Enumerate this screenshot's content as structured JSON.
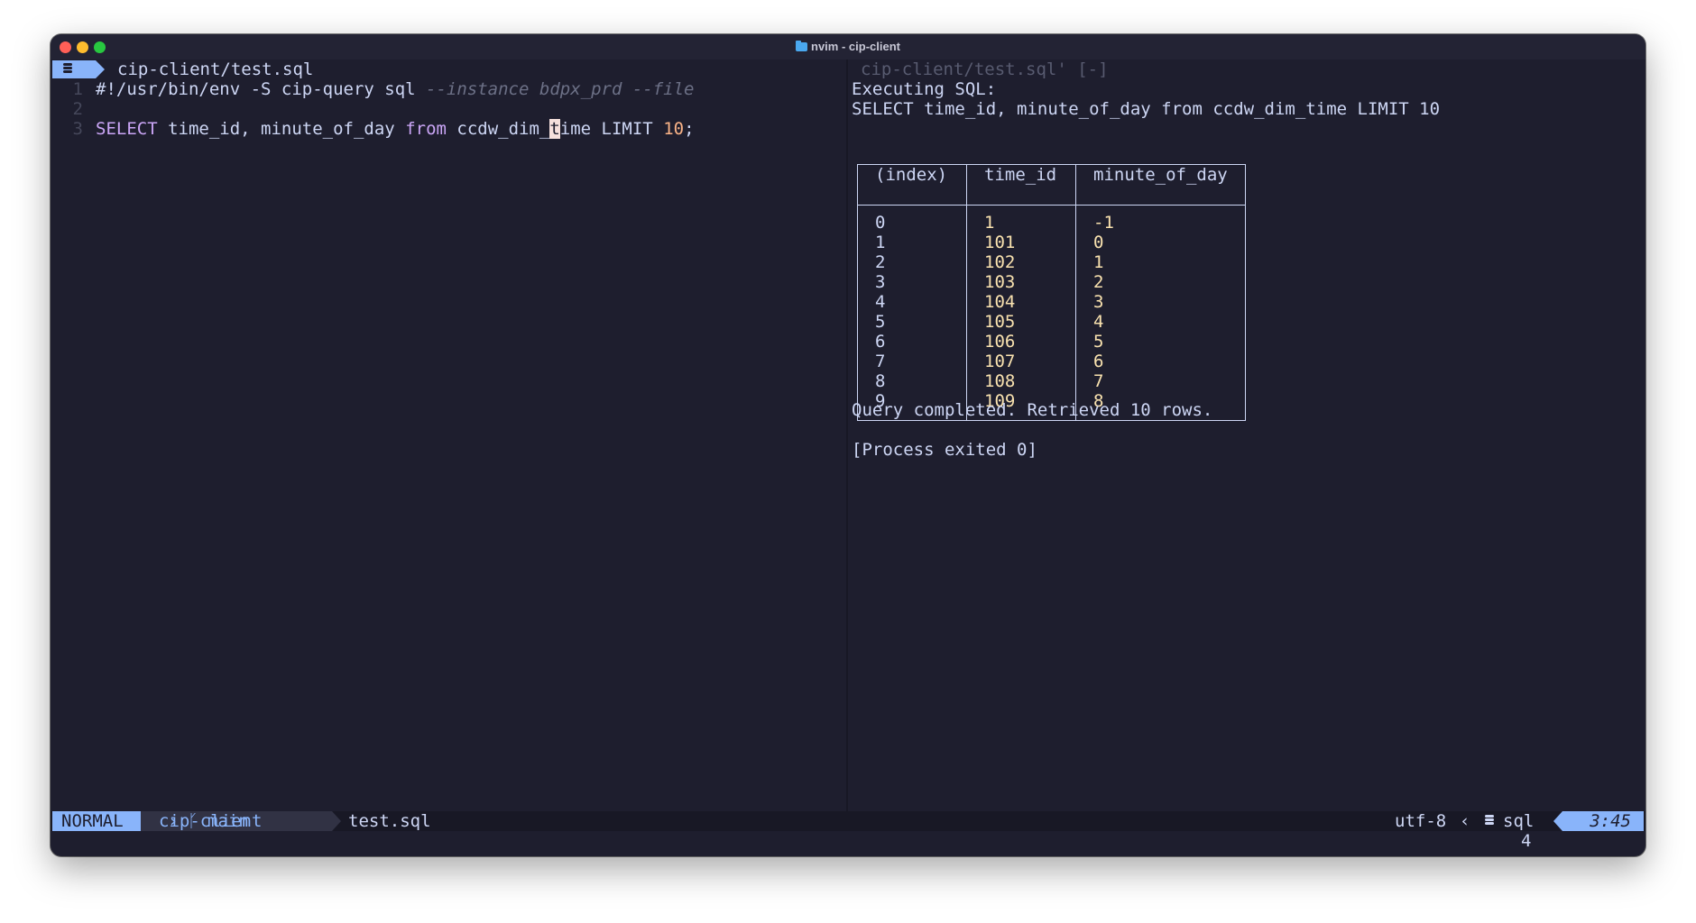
{
  "window": {
    "title": "nvim - cip-client"
  },
  "left_pane": {
    "tab_filename": "cip-client/test.sql",
    "lines": [
      {
        "num": "1",
        "parts": [
          {
            "t": "#!/usr/bin/env -S cip-query sql ",
            "c": "plain"
          },
          {
            "t": "--instance bdpx_prd --file",
            "c": "cm"
          }
        ]
      },
      {
        "num": "2",
        "parts": []
      },
      {
        "num": "3",
        "parts": [
          {
            "t": "SELECT",
            "c": "kw"
          },
          {
            "t": " time_id, minute_of_day ",
            "c": "plain"
          },
          {
            "t": "from",
            "c": "kw"
          },
          {
            "t": " ccdw_dim_",
            "c": "plain"
          },
          {
            "t": "t",
            "c": "cursor"
          },
          {
            "t": "ime LIMIT ",
            "c": "plain"
          },
          {
            "t": "10",
            "c": "num"
          },
          {
            "t": ";",
            "c": "plain"
          }
        ]
      }
    ]
  },
  "right_pane": {
    "title": "cip-client/test.sql' [-]",
    "executing_label": "Executing SQL:",
    "query": "SELECT time_id, minute_of_day from ccdw_dim_time LIMIT 10",
    "table": {
      "headers": [
        "(index)",
        "time_id",
        "minute_of_day"
      ],
      "rows": [
        [
          "0",
          "1",
          "-1"
        ],
        [
          "1",
          "101",
          "0"
        ],
        [
          "2",
          "102",
          "1"
        ],
        [
          "3",
          "103",
          "2"
        ],
        [
          "4",
          "104",
          "3"
        ],
        [
          "5",
          "105",
          "4"
        ],
        [
          "6",
          "106",
          "5"
        ],
        [
          "7",
          "107",
          "6"
        ],
        [
          "8",
          "108",
          "7"
        ],
        [
          "9",
          "109",
          "8"
        ]
      ]
    },
    "completion": "Query completed. Retrieved 10 rows.",
    "process_exit": "[Process exited 0]"
  },
  "statusline": {
    "mode": "NORMAL",
    "project": "cip-client",
    "branch": "main",
    "file": "test.sql",
    "encoding": "utf-8",
    "filetype": "sql",
    "position": "3:45"
  },
  "cmdline": {
    "right_text": "4"
  }
}
